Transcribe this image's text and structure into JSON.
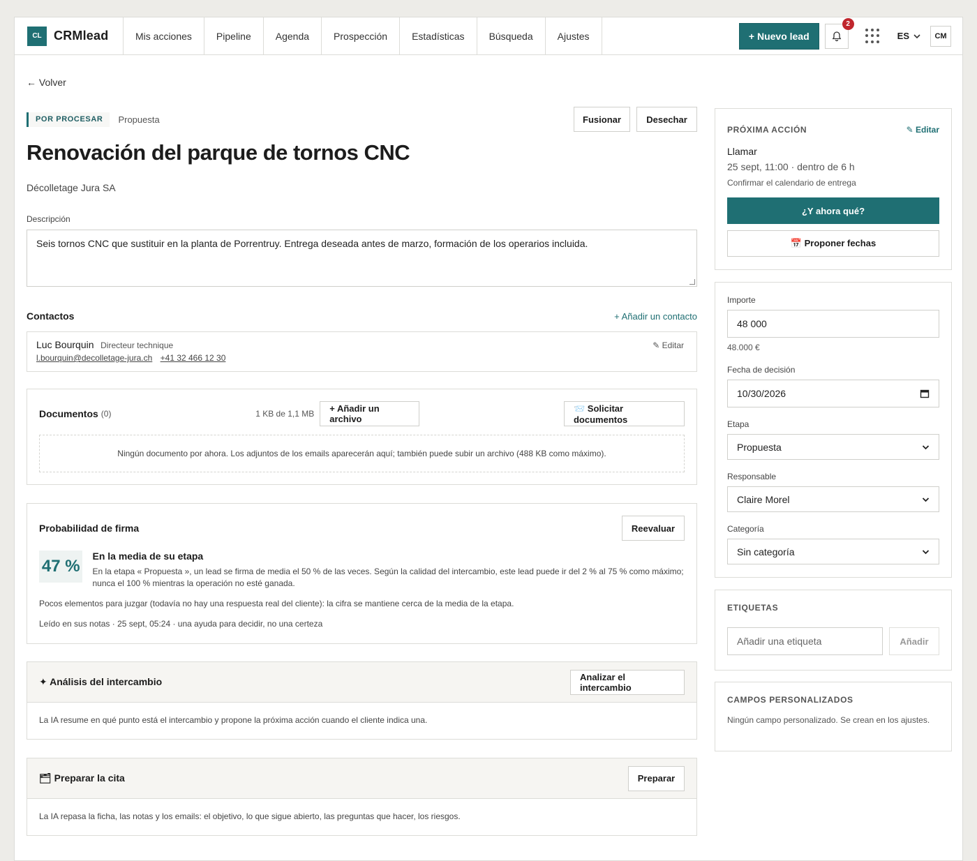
{
  "nav": {
    "brand_mark": "CL",
    "brand_name": "CRMlead",
    "tabs": [
      "Mis acciones",
      "Pipeline",
      "Agenda",
      "Prospección",
      "Estadísticas",
      "Búsqueda",
      "Ajustes"
    ],
    "new_lead": "+ Nuevo lead",
    "notif_count": "2",
    "lang": "ES",
    "avatar": "CM"
  },
  "back": "← Volver",
  "lead": {
    "status": "POR PROCESAR",
    "stage": "Propuesta",
    "merge": "Fusionar",
    "discard": "Desechar",
    "title": "Renovación del parque de tornos CNC",
    "company": "Décolletage Jura SA",
    "description_label": "Descripción",
    "description": "Seis tornos CNC que sustituir en la planta de Porrentruy. Entrega deseada antes de marzo, formación de los operarios incluida."
  },
  "contacts": {
    "title": "Contactos",
    "add": "+ Añadir un contacto",
    "items": [
      {
        "name": "Luc Bourquin",
        "role": "Directeur technique",
        "email": "l.bourquin@decolletage-jura.ch",
        "phone": "+41 32 466 12 30",
        "edit": "✎ Editar"
      }
    ]
  },
  "documents": {
    "title": "Documentos",
    "count": "(0)",
    "quota": "1 KB de 1,1 MB",
    "add_file": "+ Añadir un archivo",
    "request": "📨 Solicitar documentos",
    "empty": "Ningún documento por ahora. Los adjuntos de los emails aparecerán aquí; también puede subir un archivo (488 KB como máximo)."
  },
  "probability": {
    "title": "Probabilidad de firma",
    "reevaluate": "Reevaluar",
    "value": "47 %",
    "heading": "En la media de su etapa",
    "explanation": "En la etapa « Propuesta », un lead se firma de media el 50 % de las veces. Según la calidad del intercambio, este lead puede ir del 2 % al 75 % como máximo; nunca el 100 % mientras la operación no esté ganada.",
    "note": "Pocos elementos para juzgar (todavía no hay una respuesta real del cliente): la cifra se mantiene cerca de la media de la etapa.",
    "source": "Leído en sus notas · 25 sept, 05:24 · una ayuda para decidir, no una certeza"
  },
  "analysis": {
    "title": "✦ Análisis del intercambio",
    "button": "Analizar el intercambio",
    "body": "La IA resume en qué punto está el intercambio y propone la próxima acción cuando el cliente indica una."
  },
  "prepare": {
    "title": "🗂 Preparar la cita",
    "button": "Preparar",
    "body": "La IA repasa la ficha, las notas y los emails: el objetivo, lo que sigue abierto, las preguntas que hacer, los riesgos."
  },
  "next_action": {
    "caption": "PRÓXIMA ACCIÓN",
    "edit": "✎ Editar",
    "title": "Llamar",
    "when": "25 sept, 11:00 · dentro de 6 h",
    "note": "Confirmar el calendario de entrega",
    "what_now": "¿Y ahora qué?",
    "propose": "📅 Proponer fechas"
  },
  "details": {
    "amount_label": "Importe",
    "amount": "48 000",
    "amount_hint": "48.000 €",
    "date_label": "Fecha de decisión",
    "date": "10/30/2026",
    "stage_label": "Etapa",
    "stage": "Propuesta",
    "owner_label": "Responsable",
    "owner": "Claire Morel",
    "category_label": "Categoría",
    "category": "Sin categoría"
  },
  "tags": {
    "caption": "ETIQUETAS",
    "placeholder": "Añadir una etiqueta",
    "add": "Añadir"
  },
  "custom": {
    "caption": "CAMPOS PERSONALIZADOS",
    "empty": "Ningún campo personalizado. Se crean en los ajustes."
  },
  "colors": {
    "accent": "#1f6f73",
    "badge": "#c0262d"
  }
}
